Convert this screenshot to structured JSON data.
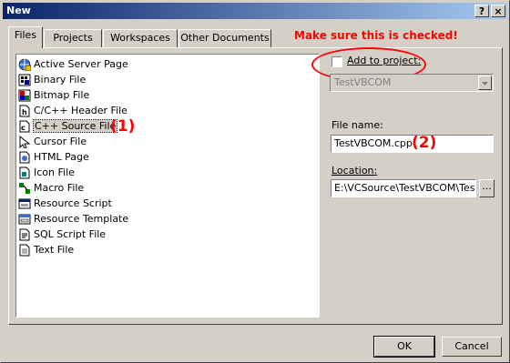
{
  "window": {
    "title": "New",
    "help_btn": "?",
    "close_btn": "×"
  },
  "tabs": [
    {
      "label": "Files"
    },
    {
      "label": "Projects"
    },
    {
      "label": "Workspaces"
    },
    {
      "label": "Other Documents"
    }
  ],
  "file_types": [
    {
      "label": "Active Server Page",
      "icon": "asp-icon"
    },
    {
      "label": "Binary File",
      "icon": "binary-file-icon"
    },
    {
      "label": "Bitmap File",
      "icon": "bitmap-icon"
    },
    {
      "label": "C/C++ Header File",
      "icon": "header-file-icon"
    },
    {
      "label": "C++ Source File",
      "icon": "source-file-icon",
      "selected": true
    },
    {
      "label": "Cursor File",
      "icon": "cursor-icon"
    },
    {
      "label": "HTML Page",
      "icon": "html-page-icon"
    },
    {
      "label": "Icon File",
      "icon": "icon-file-icon"
    },
    {
      "label": "Macro File",
      "icon": "macro-icon"
    },
    {
      "label": "Resource Script",
      "icon": "resource-script-icon"
    },
    {
      "label": "Resource Template",
      "icon": "resource-template-icon"
    },
    {
      "label": "SQL Script File",
      "icon": "sql-script-icon"
    },
    {
      "label": "Text File",
      "icon": "text-file-icon"
    }
  ],
  "annotations": {
    "checkbox_note": "Make sure this is checked!",
    "step1": "(1)",
    "step2": "(2)",
    "color": "#ff0000"
  },
  "add_to_project": {
    "label": "Add to project:",
    "checked": false,
    "project": "TestVBCOM"
  },
  "file_name": {
    "label": "File name:",
    "value": "TestVBCOM.cpp"
  },
  "location": {
    "label": "Location:",
    "value": "E:\\VCSource\\TestVBCOM\\Test",
    "browse": "..."
  },
  "buttons": {
    "ok": "OK",
    "cancel": "Cancel"
  },
  "colors": {
    "dialog_bg": "#d4d0c8",
    "title_start": "#0a246a",
    "title_end": "#a6caf0"
  }
}
